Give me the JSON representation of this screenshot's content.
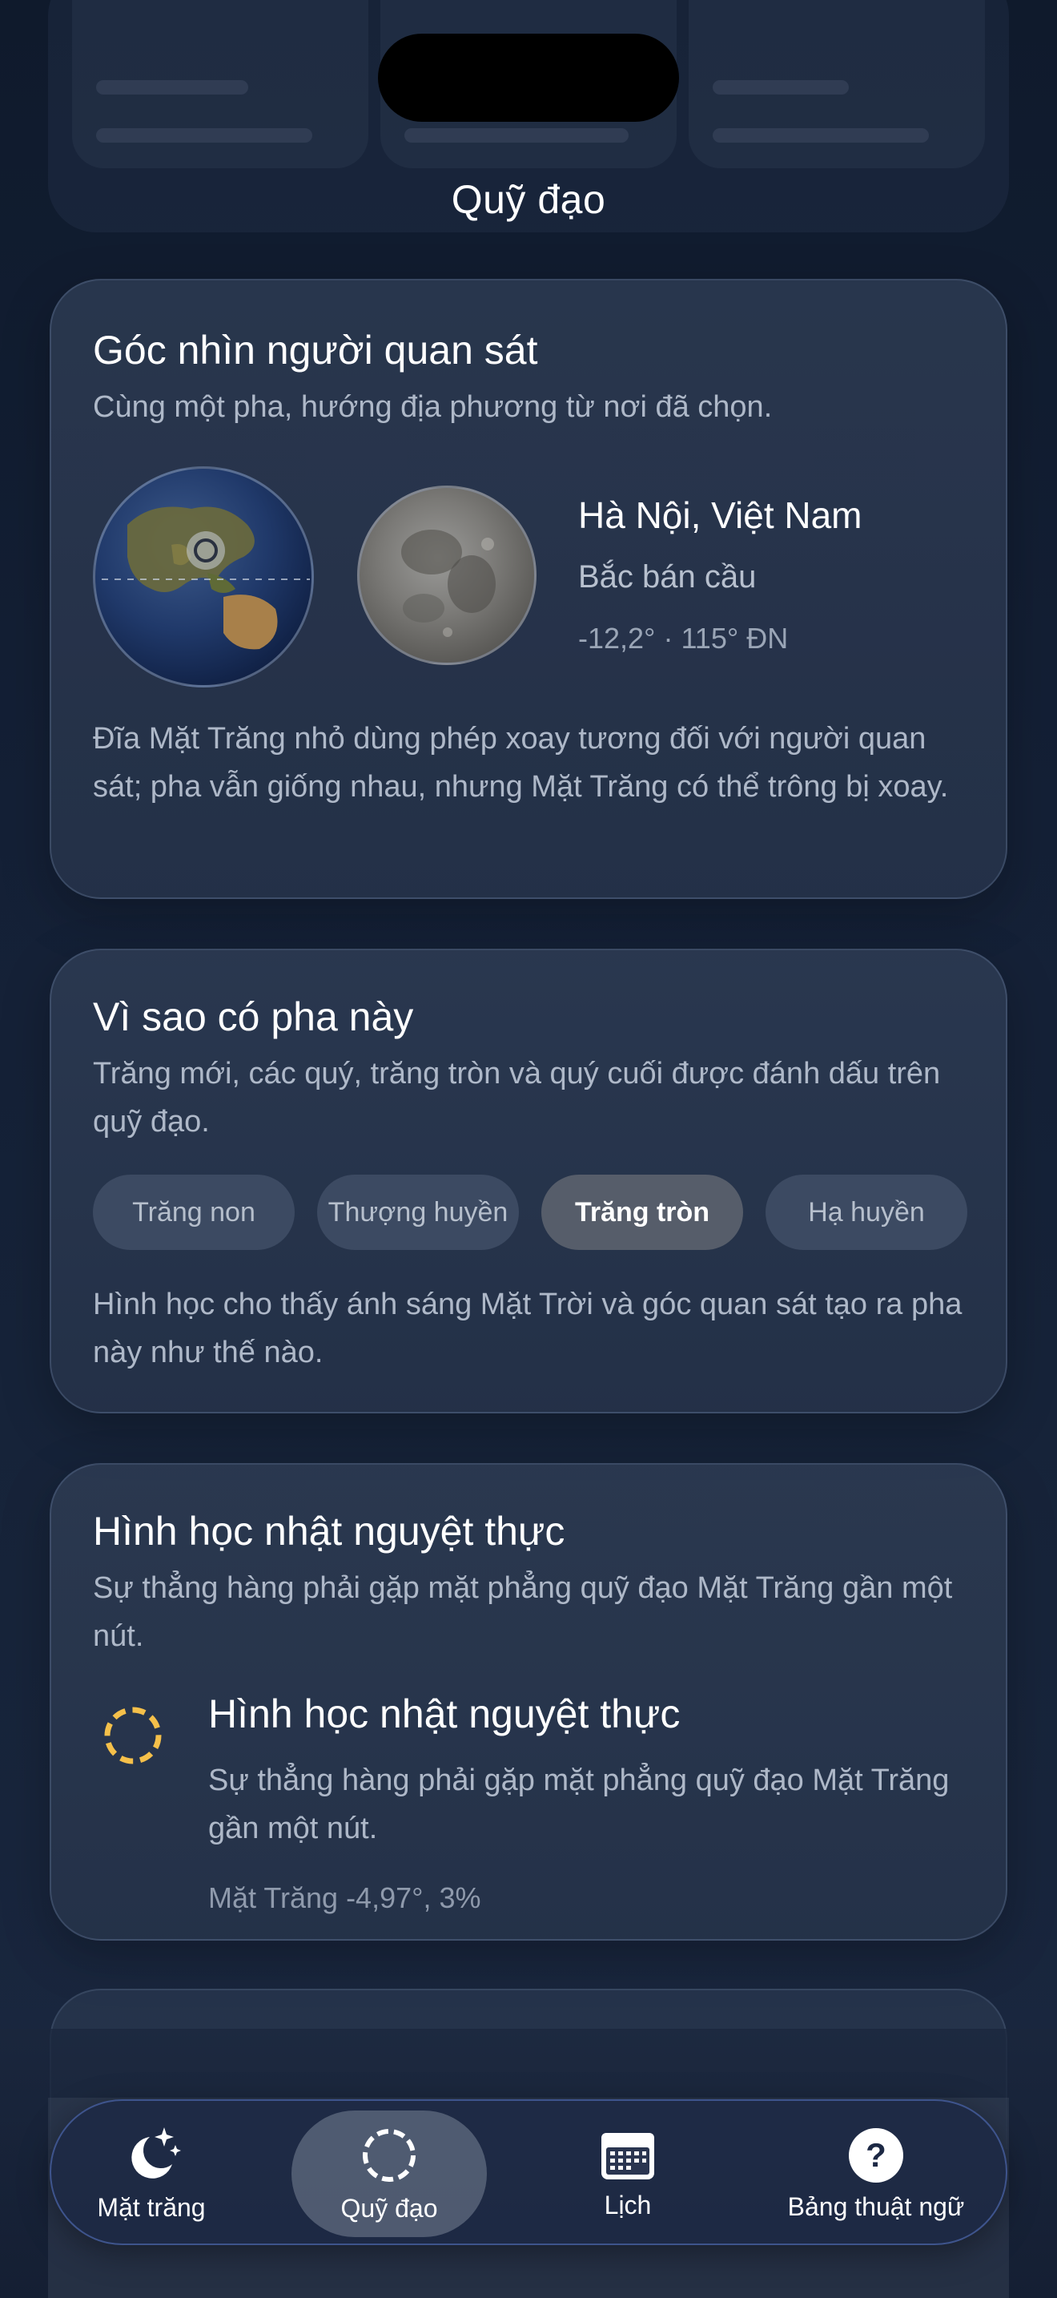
{
  "header": {
    "title": "Quỹ đạo"
  },
  "observer_card": {
    "title": "Góc nhìn người quan sát",
    "subtitle": "Cùng một pha, hướng địa phương từ nơi đã chọn.",
    "location_name": "Hà Nội, Việt Nam",
    "hemisphere": "Bắc bán cầu",
    "coordinates": "-12,2° · 115° ĐN",
    "note": "Đĩa Mặt Trăng nhỏ dùng phép xoay tương đối với người quan sát; pha vẫn giống nhau, nhưng Mặt Trăng có thể trông bị xoay."
  },
  "phase_card": {
    "title": "Vì sao có pha này",
    "subtitle": "Trăng mới, các quý, trăng tròn và quý cuối được đánh dấu trên quỹ đạo.",
    "chips": [
      {
        "label": "Trăng non",
        "active": false
      },
      {
        "label": "Thượng huyền",
        "active": false
      },
      {
        "label": "Trăng tròn",
        "active": true
      },
      {
        "label": "Hạ huyền",
        "active": false
      }
    ],
    "note": "Hình học cho thấy ánh sáng Mặt Trời và góc quan sát tạo ra pha này như thế nào."
  },
  "eclipse_card": {
    "title": "Hình học nhật nguyệt thực",
    "subtitle": "Sự thẳng hàng phải gặp mặt phẳng quỹ đạo Mặt Trăng gần một nút.",
    "item_title": "Hình học nhật nguyệt thực",
    "item_subtitle": "Sự thẳng hàng phải gặp mặt phẳng quỹ đạo Mặt Trăng gần một nút.",
    "item_meta": "Mặt Trăng -4,97°, 3%",
    "icon": "dashed-ring-icon",
    "icon_color": "#f5c04a"
  },
  "tabbar": {
    "active_index": 1,
    "tabs": [
      {
        "label": "Mặt trăng",
        "icon": "moon-stars-icon"
      },
      {
        "label": "Quỹ đạo",
        "icon": "orbit-ring-icon"
      },
      {
        "label": "Lịch",
        "icon": "calendar-icon"
      },
      {
        "label": "Bảng thuật ngữ",
        "icon": "question-icon"
      }
    ]
  },
  "colors": {
    "background": "#142036",
    "card": "#303e56",
    "accent_border": "#5a78c8",
    "muted_text": "#aeb8c8"
  }
}
